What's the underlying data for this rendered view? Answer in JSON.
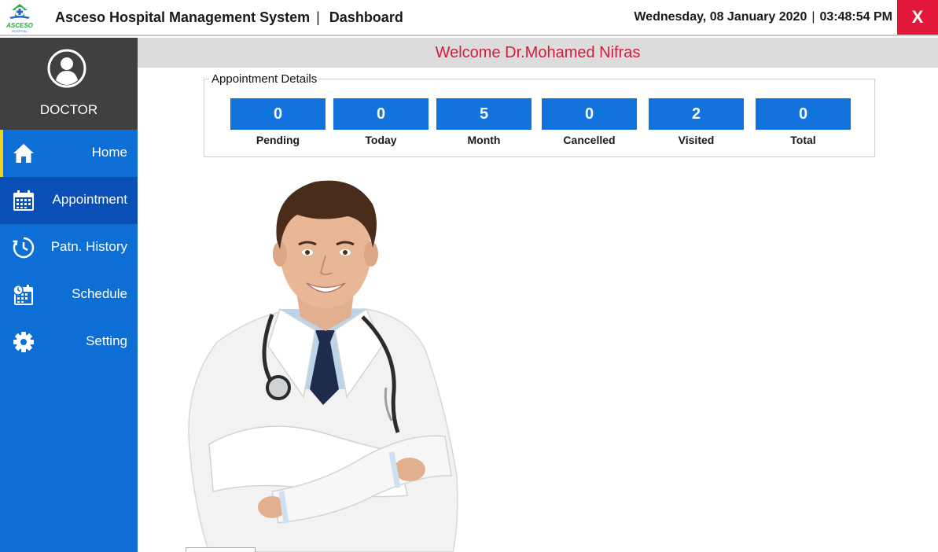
{
  "header": {
    "title": "Asceso Hospital Management System",
    "separator": "|",
    "page": "Dashboard",
    "date": "Wednesday, 08 January 2020",
    "time": "03:48:54 PM",
    "close_label": "X"
  },
  "logo": {
    "text": "ASCESO",
    "subtext": "HOSPITAL"
  },
  "profile": {
    "role": "DOCTOR",
    "icon": "user-circle-icon"
  },
  "sidebar": {
    "items": [
      {
        "label": "Home",
        "icon": "home-icon"
      },
      {
        "label": "Appointment",
        "icon": "calendar-icon"
      },
      {
        "label": "Patn. History",
        "icon": "clock-icon"
      },
      {
        "label": "Schedule",
        "icon": "schedule-icon"
      },
      {
        "label": "Setting",
        "icon": "gear-icon"
      }
    ],
    "active_index": 1
  },
  "welcome": {
    "text": "Welcome Dr.Mohamed Nifras"
  },
  "appointments": {
    "title": "Appointment Details",
    "stats": [
      {
        "value": "0",
        "label": "Pending"
      },
      {
        "value": "0",
        "label": "Today"
      },
      {
        "value": "5",
        "label": "Month"
      },
      {
        "value": "0",
        "label": "Cancelled"
      },
      {
        "value": "2",
        "label": "Visited"
      },
      {
        "value": "0",
        "label": "Total"
      }
    ]
  },
  "colors": {
    "sidebar": "#0d6fd6",
    "active": "#0a4fb5",
    "profile_bg": "#404040",
    "accent_red": "#e3173a",
    "welcome_text": "#d41c3d",
    "stat_box": "#1273dd"
  }
}
